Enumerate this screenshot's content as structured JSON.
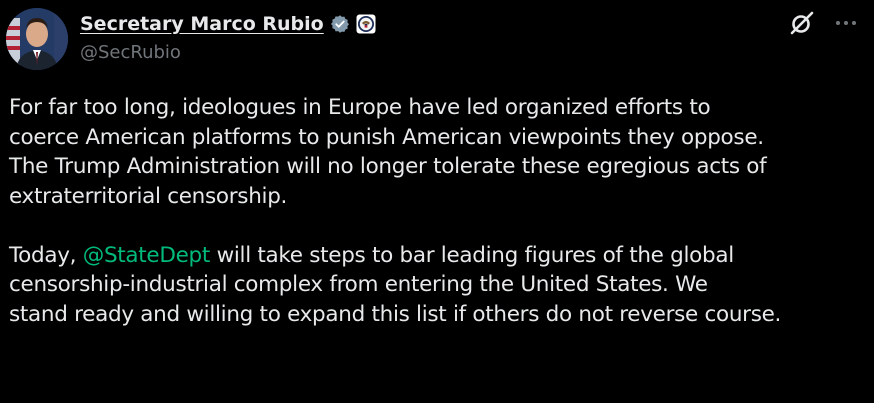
{
  "author": {
    "display_name": "Secretary Marco Rubio",
    "handle": "@SecRubio"
  },
  "icons": {
    "verified": "verified-badge-icon",
    "affiliate": "state-department-seal-icon",
    "grok": "grok-icon",
    "more": "more-options-icon"
  },
  "colors": {
    "background": "#000000",
    "text": "#e7e9ea",
    "secondary": "#71767b",
    "verified": "#829aab",
    "mention": "#00ba7c"
  },
  "post": {
    "paragraph1": {
      "line1": "For far too long, ideologues in Europe have led organized efforts to",
      "line2": "coerce American platforms to punish American viewpoints they oppose.",
      "line3": "The Trump Administration will no longer tolerate these egregious acts of",
      "line4": "extraterritorial censorship."
    },
    "paragraph2": {
      "line1_before": "Today, ",
      "mention": "@StateDept",
      "line1_after": " will take steps to bar leading figures of the global",
      "line2": "censorship-industrial complex from entering the United States. We",
      "line3": "stand ready and willing to expand this list if others do not reverse course."
    }
  }
}
